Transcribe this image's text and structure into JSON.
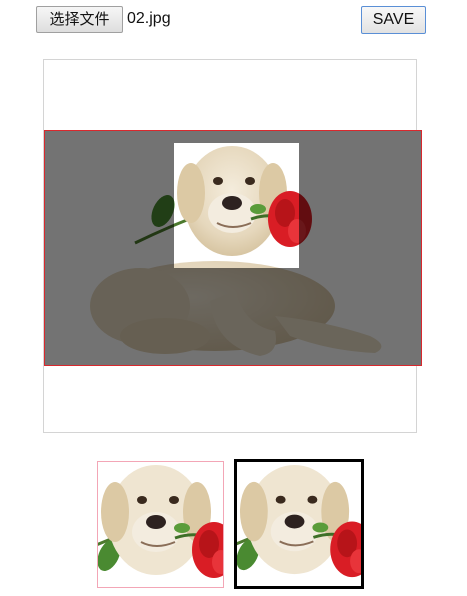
{
  "toolbar": {
    "choose_file_label": "选择文件",
    "file_name": "02.jpg",
    "save_label": "SAVE"
  },
  "colors": {
    "crop_border": "#d9282d",
    "preview_1_border": "#f3a6b6",
    "preview_2_border": "#000000",
    "save_border": "#5a8fd6"
  },
  "icons": {
    "image": "puppy-with-rose-image"
  }
}
